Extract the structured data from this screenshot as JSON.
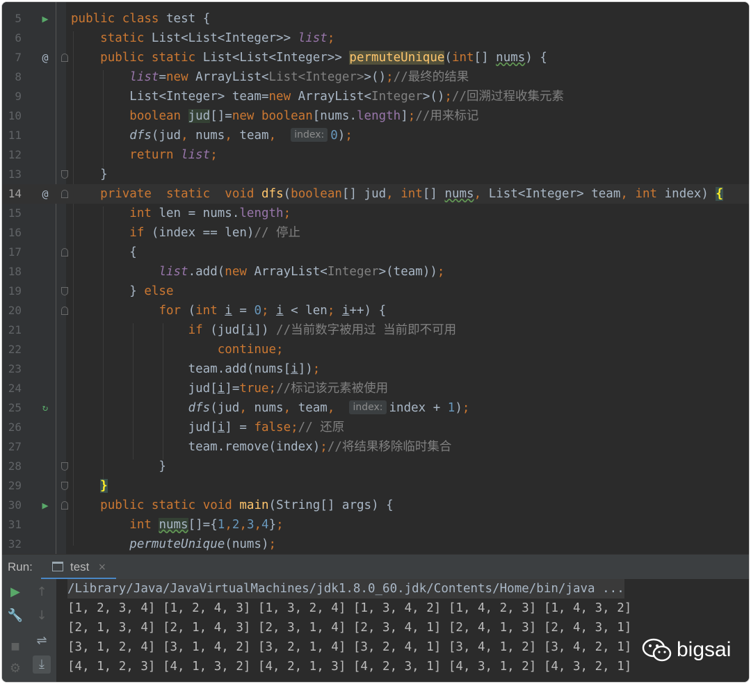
{
  "editor": {
    "lines": [
      {
        "n": "5"
      },
      {
        "n": "6"
      },
      {
        "n": "7"
      },
      {
        "n": "8"
      },
      {
        "n": "9"
      },
      {
        "n": "10"
      },
      {
        "n": "11"
      },
      {
        "n": "12"
      },
      {
        "n": "13"
      },
      {
        "n": "14"
      },
      {
        "n": "15"
      },
      {
        "n": "16"
      },
      {
        "n": "17"
      },
      {
        "n": "18"
      },
      {
        "n": "19"
      },
      {
        "n": "20"
      },
      {
        "n": "21"
      },
      {
        "n": "22"
      },
      {
        "n": "23"
      },
      {
        "n": "24"
      },
      {
        "n": "25"
      },
      {
        "n": "26"
      },
      {
        "n": "27"
      },
      {
        "n": "28"
      },
      {
        "n": "29"
      },
      {
        "n": "30"
      },
      {
        "n": "31"
      },
      {
        "n": "32"
      }
    ],
    "current_line": "14",
    "tokens": {
      "public": "public",
      "class": "class",
      "static": "static",
      "private": "private",
      "void": "void",
      "new": "new",
      "boolean": "boolean",
      "return": "return",
      "int": "int",
      "if": "if",
      "else": "else",
      "for": "for",
      "continue": "continue",
      "true": "true",
      "false": "false",
      "test": "test",
      "list": "list",
      "ListListInteger": "List<List<Integer>>",
      "permuteUnique": "permuteUnique",
      "dfs": "dfs",
      "main": "main",
      "nums": "nums",
      "jud": "jud",
      "team": "team",
      "index": "index",
      "len": "len",
      "i": "i",
      "ArrayList": "ArrayList",
      "ListInteger": "List<Integer>",
      "Integer": "Integer",
      "String": "String",
      "args": "args",
      "add": "add",
      "remove": "remove",
      "length": "length",
      "zero": "0",
      "one": "1",
      "n1": "1",
      "n2": "2",
      "n3": "3",
      "n4": "4",
      "hint_index": "index:",
      "cm_final": "//最终的结果",
      "cm_backtrack": "//回溯过程收集元素",
      "cm_mark": "//用来标记",
      "cm_stop": "// 停止",
      "cm_used": "//当前数字被用过 当前即不可用",
      "cm_mark_used": "//标记该元素被使用",
      "cm_restore": "// 还原",
      "cm_remove": "//将结果移除临时集合"
    }
  },
  "run_panel": {
    "label": "Run:",
    "tab_label": "test",
    "tab_close": "×",
    "command": "/Library/Java/JavaVirtualMachines/jdk1.8.0_60.jdk/Contents/Home/bin/java ...",
    "output_lines": [
      "[1, 2, 3, 4] [1, 2, 4, 3] [1, 3, 2, 4] [1, 3, 4, 2] [1, 4, 2, 3] [1, 4, 3, 2]",
      "[2, 1, 3, 4] [2, 1, 4, 3] [2, 3, 1, 4] [2, 3, 4, 1] [2, 4, 1, 3] [2, 4, 3, 1]",
      "[3, 1, 2, 4] [3, 1, 4, 2] [3, 2, 1, 4] [3, 2, 4, 1] [3, 4, 1, 2] [3, 4, 2, 1]",
      "[4, 1, 2, 3] [4, 1, 3, 2] [4, 2, 1, 3] [4, 2, 3, 1] [4, 3, 1, 2] [4, 3, 2, 1]"
    ]
  },
  "watermark": {
    "text": "bigsai",
    "icon": "wechat-icon"
  },
  "colors": {
    "keyword": "#cc7832",
    "method": "#ffc66d",
    "field": "#9876aa",
    "number": "#6897bb",
    "comment": "#808080",
    "text": "#a9b7c6",
    "accent": "#4a88c7",
    "run_green": "#59a869"
  }
}
